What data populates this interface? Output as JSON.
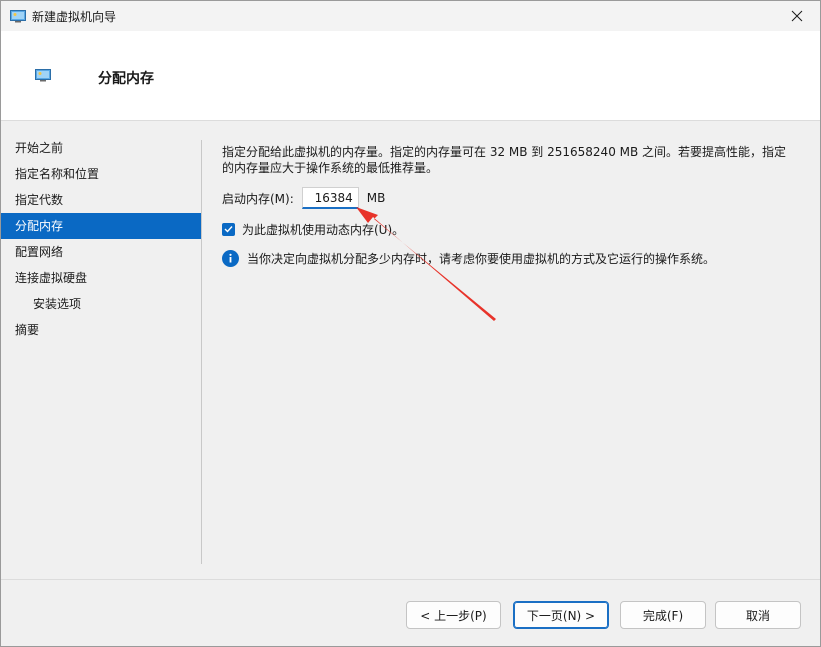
{
  "window": {
    "title": "新建虚拟机向导",
    "icon": "vm-monitor-icon"
  },
  "header": {
    "page_title": "分配内存",
    "icon": "vm-monitor-icon"
  },
  "sidebar": {
    "items": [
      {
        "label": "开始之前"
      },
      {
        "label": "指定名称和位置"
      },
      {
        "label": "指定代数"
      },
      {
        "label": "分配内存"
      },
      {
        "label": "配置网络"
      },
      {
        "label": "连接虚拟硬盘"
      },
      {
        "label": "安装选项"
      },
      {
        "label": "摘要"
      }
    ],
    "active_index": 3
  },
  "content": {
    "description": "指定分配给此虚拟机的内存量。指定的内存量可在 32 MB 到 251658240 MB 之间。若要提高性能，指定的内存量应大于操作系统的最低推荐量。",
    "startup_memory_label": "启动内存(M):",
    "startup_memory_value": "16384",
    "memory_unit": "MB",
    "dynamic_memory_label": "为此虚拟机使用动态内存(U)。",
    "dynamic_memory_checked": true,
    "info_text": "当你决定向虚拟机分配多少内存时，请考虑你要使用虚拟机的方式及它运行的操作系统。"
  },
  "footer": {
    "prev_label": "< 上一步(P)",
    "next_label": "下一页(N) >",
    "finish_label": "完成(F)",
    "cancel_label": "取消"
  },
  "colors": {
    "accent": "#0a69c4",
    "annotation_arrow": "#e8332a"
  }
}
